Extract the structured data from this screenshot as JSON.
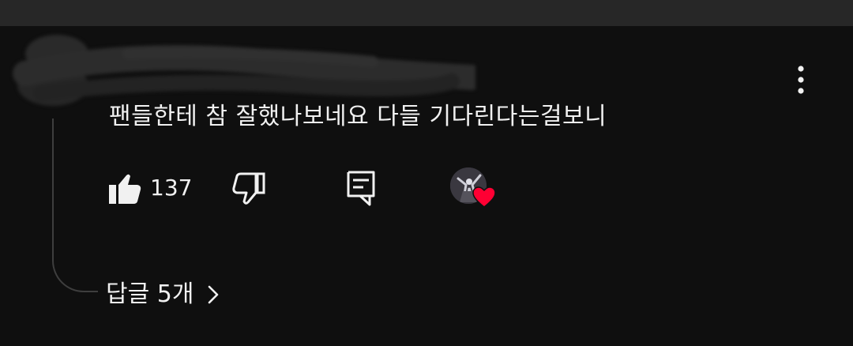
{
  "comment": {
    "text": "팬들한테 참 잘했나보네요 다들 기다린다는걸보니",
    "like_count": "137"
  },
  "replies": {
    "label": "답글 5개"
  },
  "icons": {
    "like": "thumb-up-icon",
    "dislike": "thumb-down-icon",
    "reply": "comment-icon",
    "menu": "more-vertical-icon",
    "creator_heart": "heart-icon",
    "replies_chevron": "chevron-right-icon"
  },
  "colors": {
    "background": "#0f0f0f",
    "top_bar": "#272727",
    "text": "#f1f1f1",
    "heart": "#ff0033",
    "thread_line": "#3e3e3e"
  }
}
